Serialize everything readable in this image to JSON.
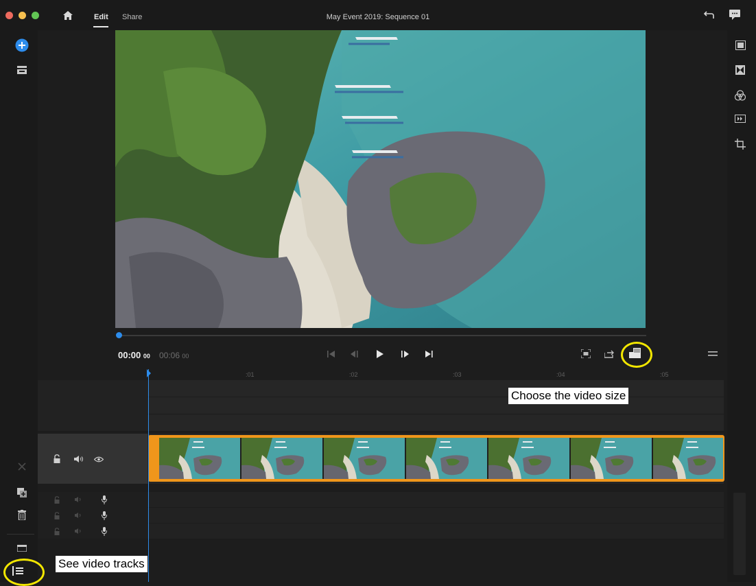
{
  "titlebar": {
    "tabs": [
      {
        "label": "Edit"
      },
      {
        "label": "Share"
      }
    ],
    "title": "May Event 2019: Sequence 01",
    "icons": [
      "home-icon",
      "undo-icon",
      "comments-icon"
    ],
    "traffic_colors": [
      "#ed6a5e",
      "#f5bf4f",
      "#62c554"
    ]
  },
  "player": {
    "current_time": "00:00",
    "current_frames": "00",
    "total_time": "00:06",
    "total_frames": "00",
    "progress": 0
  },
  "timeline": {
    "ruler_labels": [
      ":01",
      ":02",
      ":03",
      ":04",
      ":05"
    ],
    "video_track_icons": [
      "lock-icon",
      "speaker-icon",
      "eye-icon"
    ],
    "audio_track_icons": [
      "lock-icon",
      "speaker-icon",
      "microphone-icon"
    ],
    "clip_frame_count": 7,
    "clip_color": "#f0961b"
  },
  "annotations": {
    "video_size": "Choose the video size",
    "video_tracks": "See video tracks",
    "ring_color": "#f2e600"
  },
  "colors": {
    "accent": "#2d8ceb"
  }
}
